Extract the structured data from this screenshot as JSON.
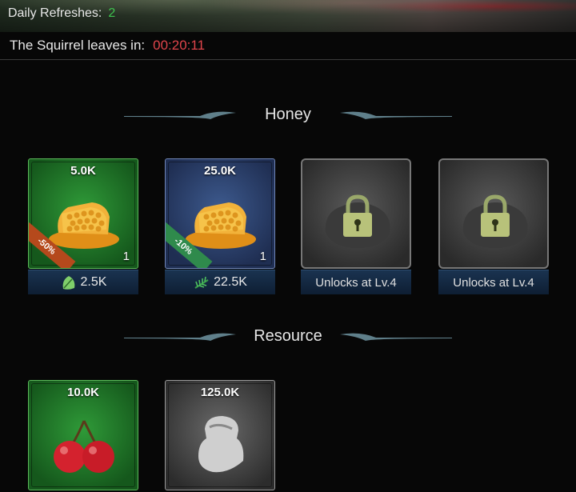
{
  "header": {
    "refresh_label": "Daily Refreshes:",
    "refresh_count": "2",
    "squirrel_label": "The Squirrel leaves in:",
    "timer": "00:20:11"
  },
  "sections": {
    "honey": {
      "title": "Honey",
      "items": [
        {
          "amount": "5.0K",
          "qty": "1",
          "discount": "-50%",
          "price": "2.5K",
          "price_icon": "leaf-icon"
        },
        {
          "amount": "25.0K",
          "qty": "1",
          "discount": "-10%",
          "price": "22.5K",
          "price_icon": "herb-icon"
        },
        {
          "unlock_text": "Unlocks at Lv.4"
        },
        {
          "unlock_text": "Unlocks at Lv.4"
        }
      ]
    },
    "resource": {
      "title": "Resource",
      "items": [
        {
          "amount": "10.0K",
          "item_icon": "cherry-icon"
        },
        {
          "amount": "125.0K",
          "item_icon": "resource-icon"
        }
      ]
    }
  },
  "colors": {
    "refresh_count": "#3ec44f",
    "timer": "#e0454b",
    "tile_green": "#2f9a38",
    "tile_blue": "#3d5a8e",
    "ribbon_orange": "#b5491c",
    "ribbon_teal": "#2f8a4c"
  }
}
